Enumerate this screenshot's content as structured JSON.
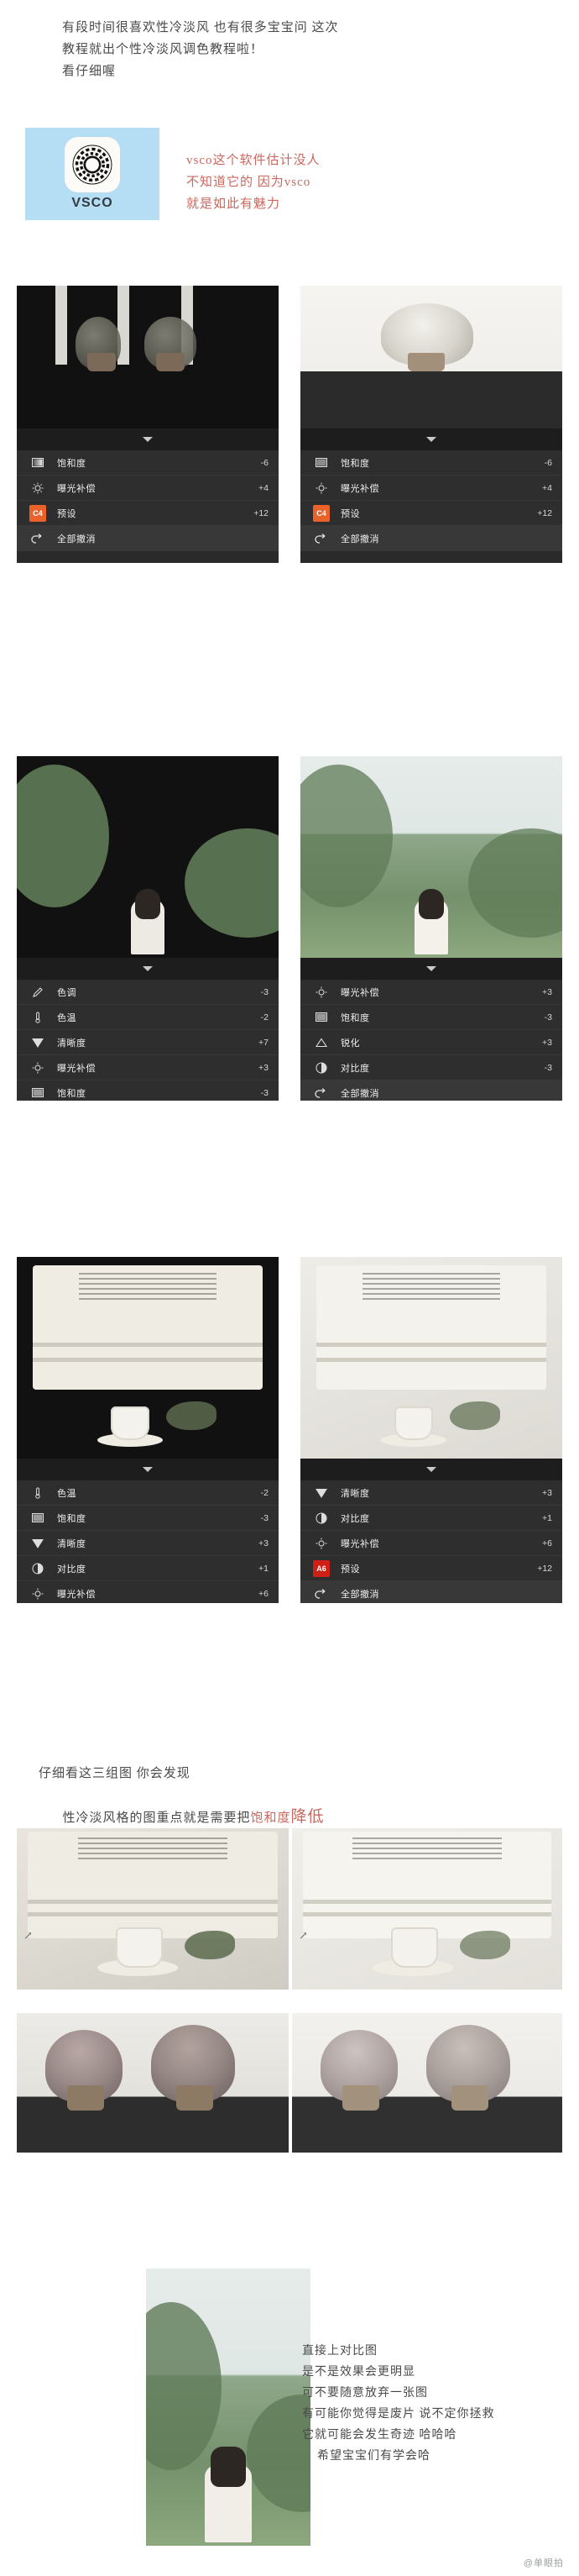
{
  "intro": {
    "line1": "有段时间很喜欢性冷淡风 也有很多宝宝问 这次",
    "line2": "教程就出个性冷淡风调色教程啦！",
    "line3": "看仔细喔"
  },
  "app": {
    "name": "VSCO",
    "icon": "vsco-circle-icon",
    "card_bg": "#b5ddf4",
    "note_line1": "vsco这个软件估计没人",
    "note_line2": "不知道它的 因为vsco",
    "note_line3": "就是如此有魅力",
    "note_color": "#c9685f"
  },
  "editor": {
    "collapse_icon": "chevron-down-icon",
    "undo_icon": "undo-arrow-icon",
    "undo_label": "全部撤消",
    "groups": [
      {
        "id": "group-1-left",
        "photo": "white-flowers-vase-dark",
        "rows": [
          {
            "icon": "saturation-icon",
            "label": "饱和度",
            "value": "-6"
          },
          {
            "icon": "exposure-icon",
            "label": "曝光补偿",
            "value": "+4"
          },
          {
            "icon": "preset-chip",
            "label": "预设",
            "value": "+12",
            "preset": "C4",
            "preset_color": "#e8622a"
          }
        ],
        "has_undo": true
      },
      {
        "id": "group-1-right",
        "photo": "white-flowers-bright",
        "rows": [
          {
            "icon": "saturation-icon",
            "label": "饱和度",
            "value": "-6"
          },
          {
            "icon": "exposure-icon",
            "label": "曝光补偿",
            "value": "+4"
          },
          {
            "icon": "preset-chip",
            "label": "预设",
            "value": "+12",
            "preset": "C4",
            "preset_color": "#e8622a"
          }
        ],
        "has_undo": true
      },
      {
        "id": "group-2-left",
        "photo": "girl-green-field",
        "rows": [
          {
            "icon": "tone-pen-icon",
            "label": "色调",
            "value": "-3"
          },
          {
            "icon": "temperature-icon",
            "label": "色温",
            "value": "-2"
          },
          {
            "icon": "clarity-icon",
            "label": "清晰度",
            "value": "+7"
          },
          {
            "icon": "exposure-icon",
            "label": "曝光补偿",
            "value": "+3"
          },
          {
            "icon": "saturation-icon",
            "label": "饱和度",
            "value": "-3"
          }
        ],
        "has_undo": false
      },
      {
        "id": "group-2-right",
        "photo": "girl-green-field-cool",
        "rows": [
          {
            "icon": "exposure-icon",
            "label": "曝光补偿",
            "value": "+3"
          },
          {
            "icon": "saturation-icon",
            "label": "饱和度",
            "value": "-3"
          },
          {
            "icon": "sharpen-icon",
            "label": "锐化",
            "value": "+3"
          },
          {
            "icon": "contrast-icon",
            "label": "对比度",
            "value": "-3"
          }
        ],
        "has_undo": true
      },
      {
        "id": "group-3-left",
        "photo": "canvas-bag-coffee",
        "rows": [
          {
            "icon": "temperature-icon",
            "label": "色温",
            "value": "-2"
          },
          {
            "icon": "saturation-icon",
            "label": "饱和度",
            "value": "-3"
          },
          {
            "icon": "clarity-icon",
            "label": "清晰度",
            "value": "+3"
          },
          {
            "icon": "contrast-icon",
            "label": "对比度",
            "value": "+1"
          },
          {
            "icon": "exposure-icon",
            "label": "曝光补偿",
            "value": "+6"
          }
        ],
        "has_undo": false
      },
      {
        "id": "group-3-right",
        "photo": "canvas-bag-coffee-cool",
        "rows": [
          {
            "icon": "clarity-icon",
            "label": "清晰度",
            "value": "+3"
          },
          {
            "icon": "contrast-icon",
            "label": "对比度",
            "value": "+1"
          },
          {
            "icon": "exposure-icon",
            "label": "曝光补偿",
            "value": "+6"
          },
          {
            "icon": "preset-chip",
            "label": "预设",
            "value": "+12",
            "preset": "A6",
            "preset_color": "#cf2016"
          }
        ],
        "has_undo": true
      }
    ]
  },
  "mid_note": {
    "line1": "仔细看这三组图 你会发现",
    "line2_plain": "性冷淡风格的图重点就是需要把",
    "line2_red1": "饱和度",
    "line2_red2": "降低",
    "red_color": "#c9685f"
  },
  "comparison": {
    "bag_before": "canvas-bag-original",
    "bag_after": "canvas-bag-edited",
    "flower_before": "dried-flowers-original",
    "flower_after": "dried-flowers-edited",
    "final": "girl-field-final",
    "marks": [
      "↗",
      "↗"
    ]
  },
  "bottom_note": {
    "line1": "直接上对比图",
    "line2": "是不是效果会更明显",
    "line3": "可不要随意放弃一张图",
    "line4": "有可能你觉得是废片 说不定你拯救",
    "line5": "它就可能会发生奇迹 哈哈哈",
    "line6": "希望宝宝们有学会哈"
  },
  "watermark": "@单眼拍"
}
